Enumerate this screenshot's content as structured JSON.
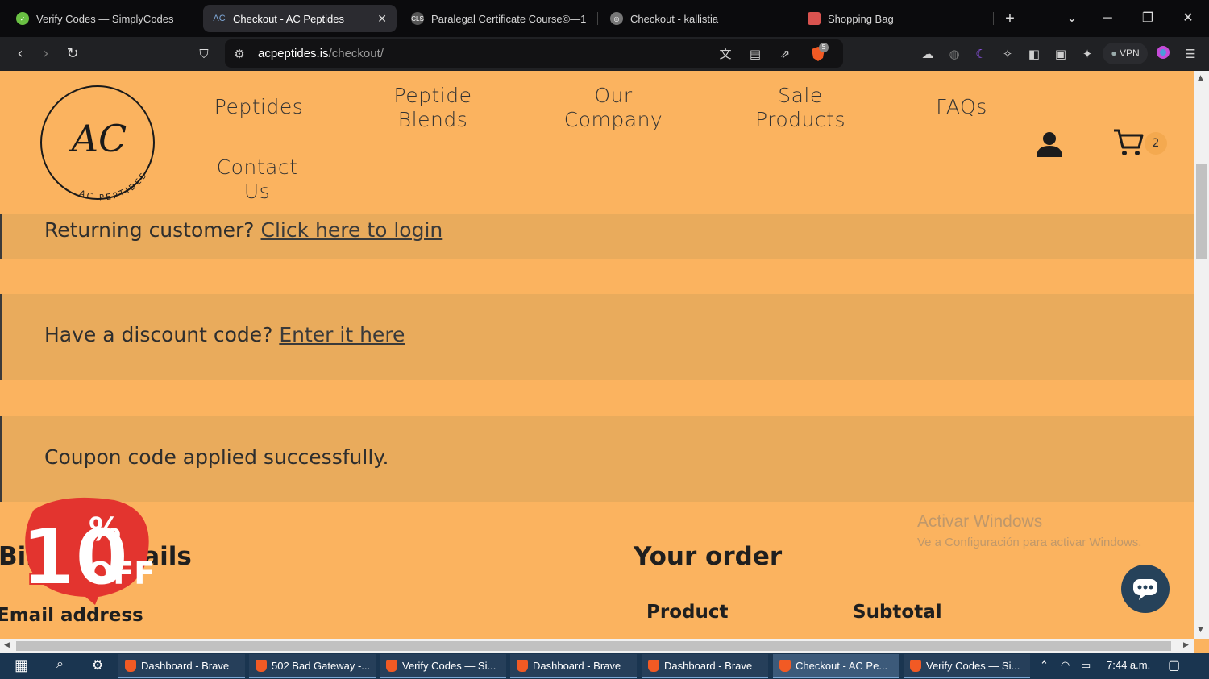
{
  "browser": {
    "tabs": [
      {
        "title": "Verify Codes — SimplyCodes",
        "active": false
      },
      {
        "title": "Checkout - AC Peptides",
        "active": true
      },
      {
        "title": "Paralegal Certificate Course©—1",
        "active": false
      },
      {
        "title": "Checkout - kallistia",
        "active": false
      },
      {
        "title": "Shopping Bag",
        "active": false
      }
    ],
    "url_host": "acpeptides.is",
    "url_path": "/checkout/",
    "vpn_label": "VPN",
    "shield_badge": "5"
  },
  "header": {
    "logo_text": "AC",
    "logo_ring_text": "AC PEPTIDES",
    "nav": [
      {
        "label_line1": "Peptides",
        "label_line2": ""
      },
      {
        "label_line1": "Peptide",
        "label_line2": "Blends"
      },
      {
        "label_line1": "Our",
        "label_line2": "Company"
      },
      {
        "label_line1": "Sale",
        "label_line2": "Products"
      },
      {
        "label_line1": "FAQs",
        "label_line2": ""
      },
      {
        "label_line1": "Contact",
        "label_line2": "Us"
      }
    ],
    "cart_count": "2"
  },
  "notices": {
    "returning_text": "Returning customer?",
    "returning_link": "Click here to login",
    "discount_text": "Have a discount code?",
    "discount_link": "Enter it here",
    "coupon_message": "Coupon code applied successfully."
  },
  "billing": {
    "heading": "Billing details",
    "email_label": "Email address"
  },
  "order": {
    "heading": "Your order",
    "col_product": "Product",
    "col_subtotal": "Subtotal"
  },
  "promo": {
    "text_main": "10",
    "text_pct": "%",
    "text_off": "OFF"
  },
  "watermark": {
    "line1": "Activar Windows",
    "line2": "Ve a Configuración para activar Windows."
  },
  "taskbar": {
    "items": [
      {
        "label": "Dashboard - Brave",
        "active": false
      },
      {
        "label": "502 Bad Gateway -...",
        "active": false
      },
      {
        "label": "Verify Codes — Si...",
        "active": false
      },
      {
        "label": "Dashboard - Brave",
        "active": false
      },
      {
        "label": "Dashboard - Brave",
        "active": false
      },
      {
        "label": "Checkout - AC Pe...",
        "active": true
      },
      {
        "label": "Verify Codes — Si...",
        "active": false
      }
    ],
    "clock": "7:44 a.m."
  },
  "colors": {
    "page_bg": "#fbb35f",
    "notice_bg": "#e9ab5c",
    "chat_button": "#26425a",
    "promo_red": "#e3342f"
  }
}
